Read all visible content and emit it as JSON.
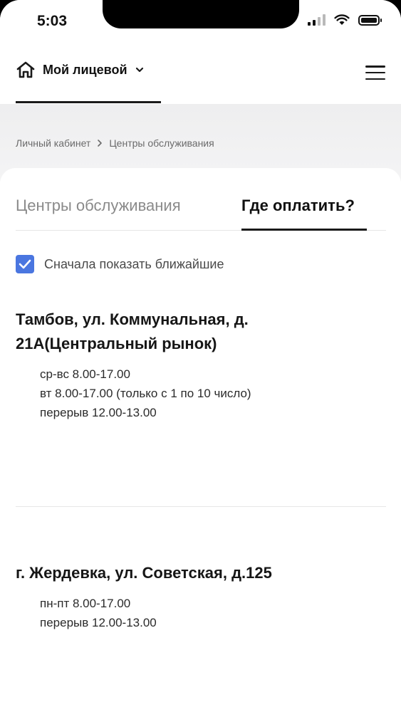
{
  "status_bar": {
    "time": "5:03"
  },
  "header": {
    "account_label": "Мой лицевой",
    "icons": [
      "home-icon",
      "chevron-down-icon",
      "menu-icon"
    ]
  },
  "breadcrumb": {
    "items": [
      "Личный кабинет",
      "Центры обслуживания"
    ]
  },
  "tabs": [
    {
      "label": "Центры обслуживания",
      "active": false
    },
    {
      "label": "Где оплатить?",
      "active": true
    }
  ],
  "filter": {
    "label": "Сначала показать ближайшие",
    "checked": true
  },
  "locations": [
    {
      "title_line1": "Тамбов, ул. Коммунальная, д.",
      "title_line2": "21А(Центральный рынок)",
      "hours": [
        "ср-вс 8.00-17.00",
        "вт 8.00-17.00 (только с 1 по 10 число)",
        "перерыв 12.00-13.00"
      ]
    },
    {
      "title_line1": "г. Жердевка, ул. Советская, д.125",
      "hours": [
        "пн-пт 8.00-17.00",
        "перерыв 12.00-13.00"
      ]
    }
  ],
  "colors": {
    "accent": "#4a76e0",
    "text": "#111111",
    "muted": "#8a8a8a",
    "background_grey": "#eeeeef"
  }
}
